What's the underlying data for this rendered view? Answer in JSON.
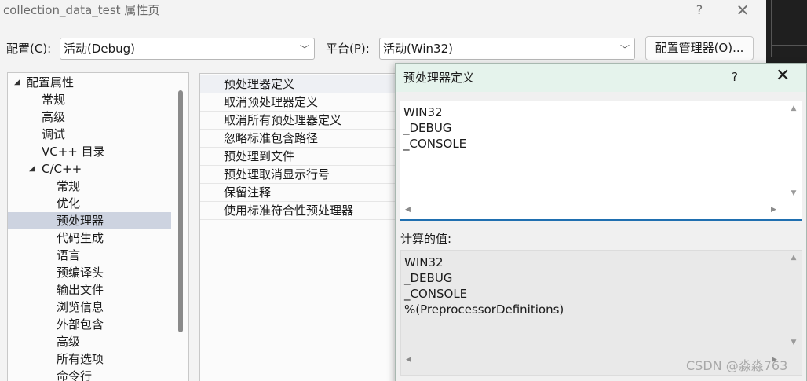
{
  "window": {
    "title": "collection_data_test 属性页",
    "help_glyph": "?",
    "close_glyph": "✕"
  },
  "config": {
    "config_label": "配置(C):",
    "config_value": "活动(Debug)",
    "platform_label": "平台(P):",
    "platform_value": "活动(Win32)",
    "manager_button": "配置管理器(O)...",
    "dropdown_glyph": "﹀"
  },
  "tree": {
    "root_label": "配置属性",
    "items": [
      "常规",
      "高级",
      "调试",
      "VC++ 目录"
    ],
    "cpp_label": "C/C++",
    "cpp_children": [
      "常规",
      "优化",
      "预处理器",
      "代码生成",
      "语言",
      "预编译头",
      "输出文件",
      "浏览信息",
      "外部包含",
      "高级",
      "所有选项",
      "命令行"
    ],
    "expanded_glyph": "◢"
  },
  "properties": {
    "rows": [
      "预处理器定义",
      "取消预处理器定义",
      "取消所有预处理器定义",
      "忽略标准包含路径",
      "预处理到文件",
      "预处理取消显示行号",
      "保留注释",
      "使用标准符合性预处理器"
    ]
  },
  "dialog": {
    "title": "预处理器定义",
    "help_glyph": "?",
    "close_glyph": "✕",
    "edit_lines": [
      "WIN32",
      "_DEBUG",
      "_CONSOLE"
    ],
    "computed_label": "计算的值:",
    "computed_lines": [
      "WIN32",
      "_DEBUG",
      "_CONSOLE",
      "%(PreprocessorDefinitions)"
    ],
    "scroll_up": "▲",
    "scroll_down": "▼",
    "scroll_left": "◀",
    "scroll_right": "▶"
  },
  "watermark": "CSDN @淼淼763",
  "colors": {
    "dialog_header": "#e5f3ec",
    "selected_tree": "#cdd3e0",
    "accent_underline": "#1f6fb0"
  }
}
